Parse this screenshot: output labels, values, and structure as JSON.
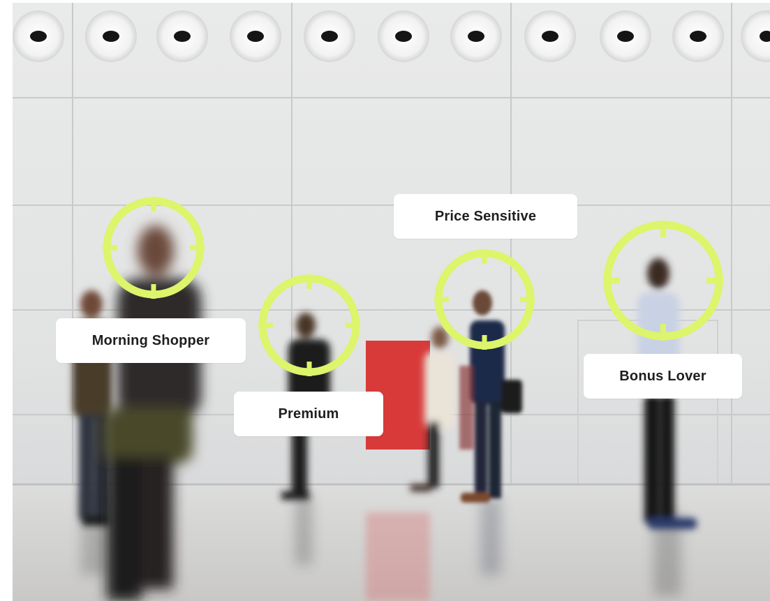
{
  "colors": {
    "accent": "#dcf56a",
    "label_background": "#ffffff",
    "label_text": "#1f1f1f",
    "red_panel": "#d83a3a"
  },
  "icons": [
    "target-crosshair-icon"
  ],
  "labels": {
    "morning_shopper": "Morning Shopper",
    "premium": "Premium",
    "price_sensitive": "Price Sensitive",
    "bonus_lover": "Bonus Lover"
  }
}
